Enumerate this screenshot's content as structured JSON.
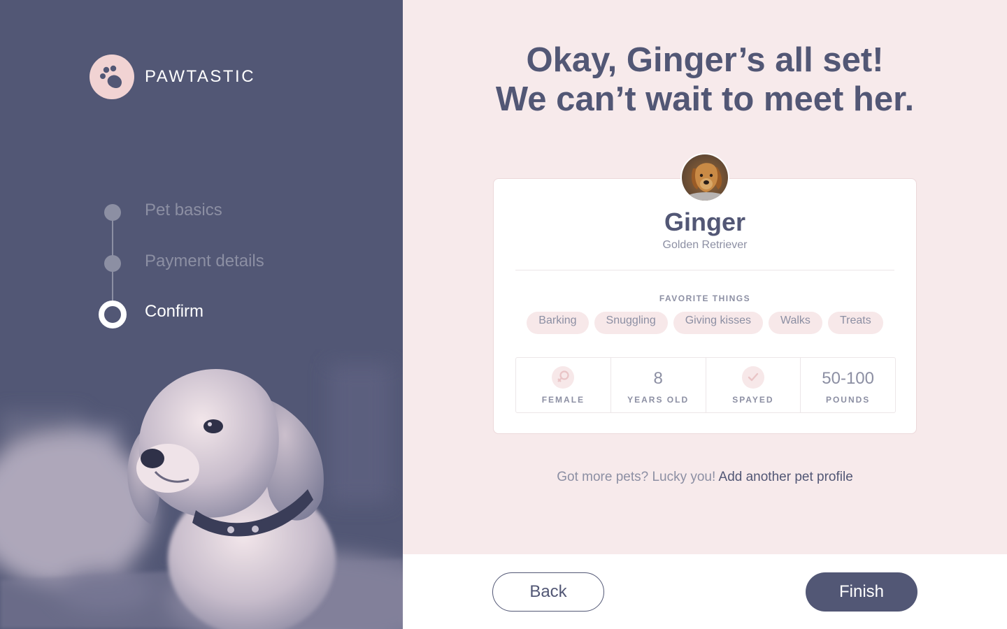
{
  "brand": {
    "name": "PAWTASTIC",
    "logo_icon": "paw-icon"
  },
  "steps": [
    {
      "label": "Pet basics",
      "state": "done"
    },
    {
      "label": "Payment details",
      "state": "done"
    },
    {
      "label": "Confirm",
      "state": "current"
    }
  ],
  "headline": {
    "line1": "Okay, Ginger’s all set!",
    "line2": "We can’t wait to meet her."
  },
  "pet": {
    "name": "Ginger",
    "breed": "Golden Retriever",
    "favorites_title": "FAVORITE THINGS",
    "favorites": [
      "Barking",
      "Snuggling",
      "Giving kisses",
      "Walks",
      "Treats"
    ],
    "stats": [
      {
        "icon": "female-icon",
        "label": "FEMALE"
      },
      {
        "value": "8",
        "label": "YEARS OLD"
      },
      {
        "icon": "check-icon",
        "label": "SPAYED"
      },
      {
        "value": "50-100",
        "label": "POUNDS"
      }
    ]
  },
  "more_pets": {
    "text": "Got more pets? Lucky you!",
    "link": "Add another pet profile"
  },
  "buttons": {
    "back": "Back",
    "finish": "Finish"
  },
  "colors": {
    "primary": "#525775",
    "muted": "#8c8fa3",
    "blush": "#f7eaeb",
    "accent": "#f1d3d3"
  }
}
